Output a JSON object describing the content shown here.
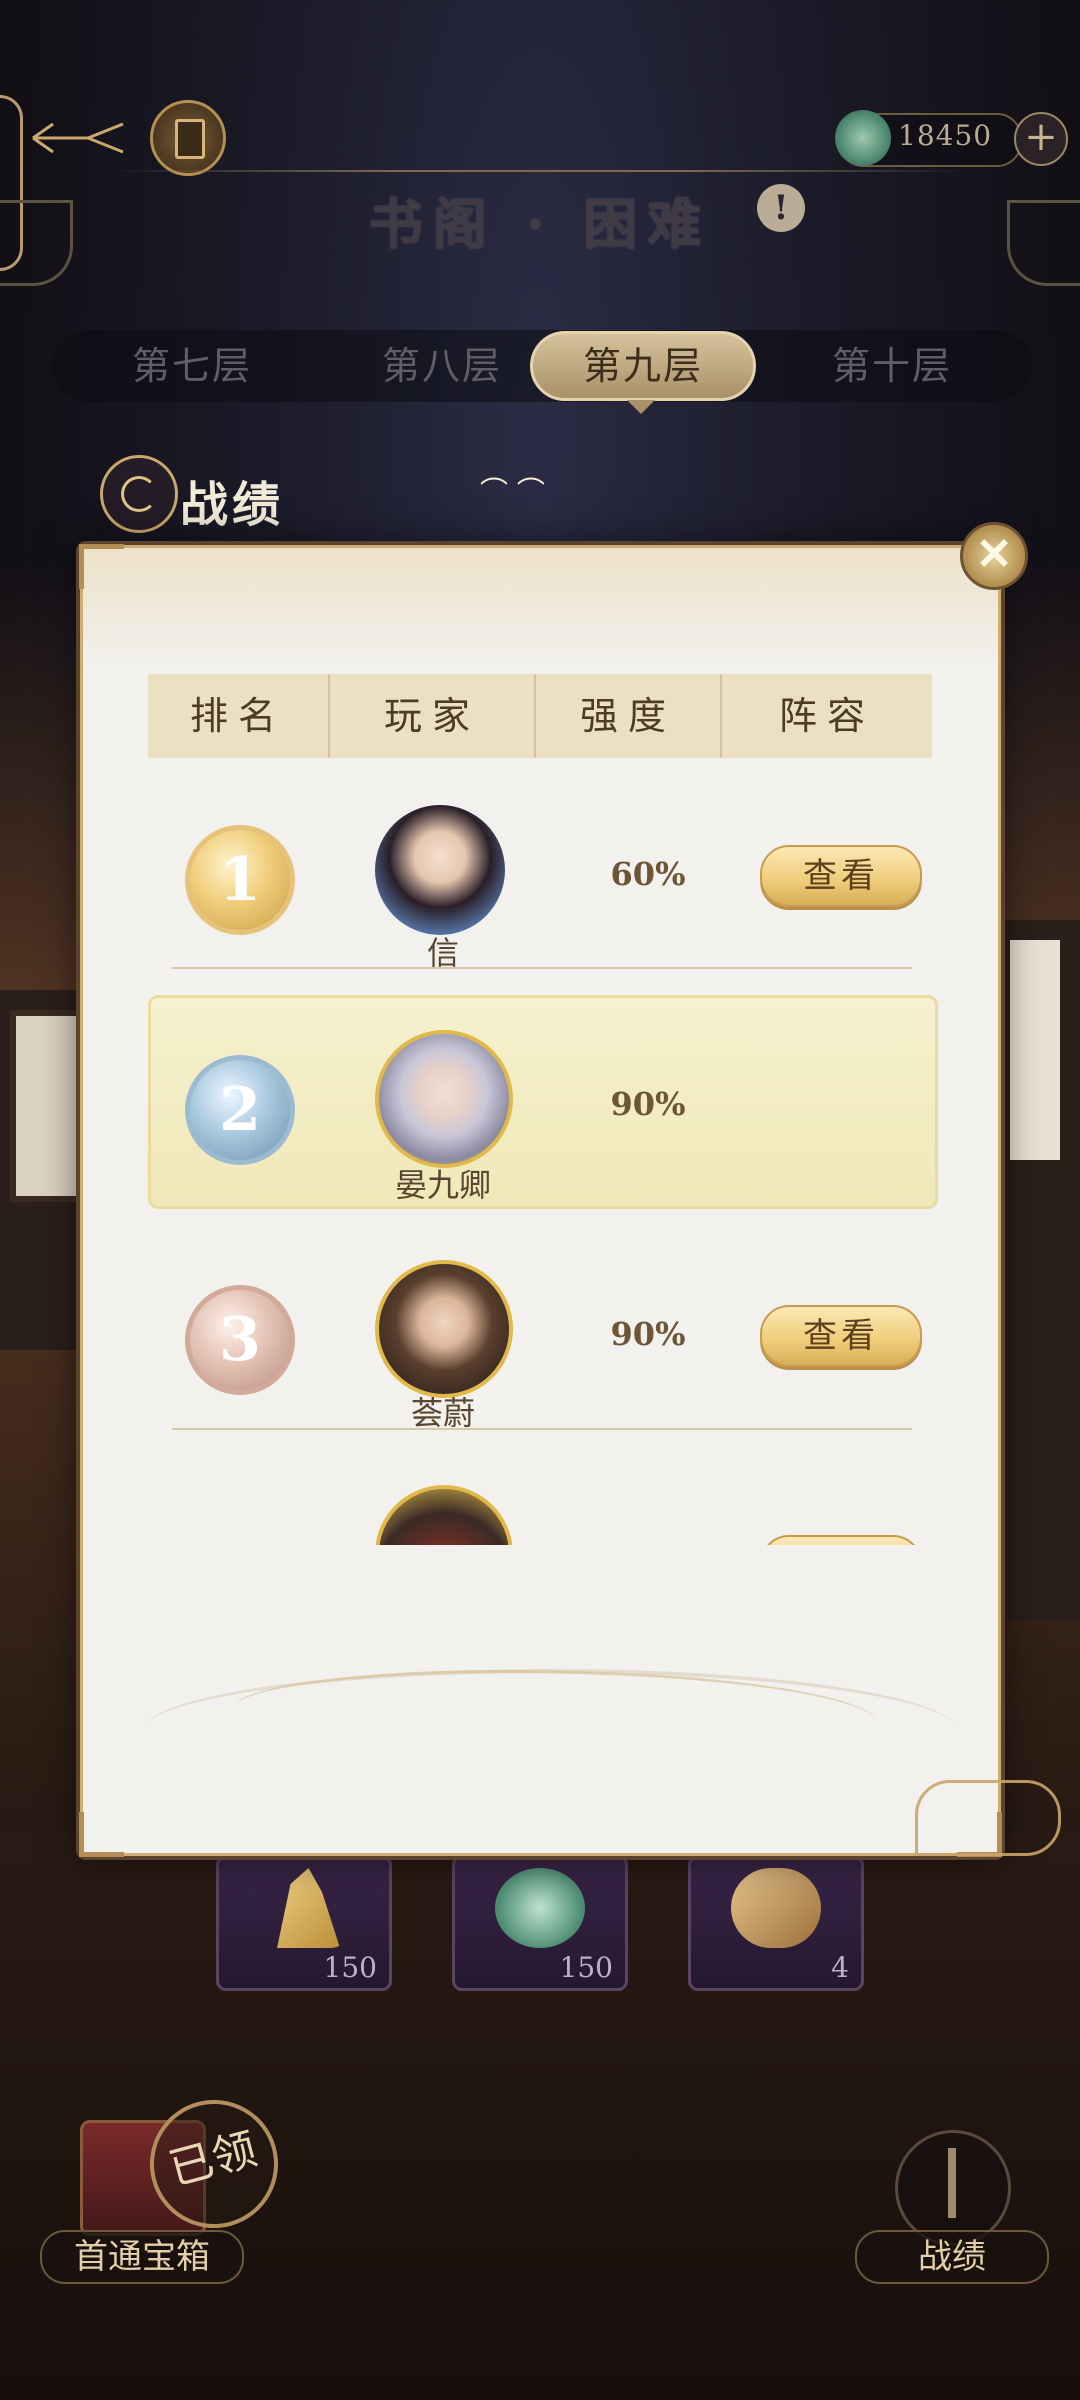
{
  "header": {
    "title": "书阁 · 困难",
    "currency_value": "18450",
    "plus_symbol": "+",
    "help_symbol": "!"
  },
  "tabs": [
    {
      "label": "第七层",
      "active": false
    },
    {
      "label": "第八层",
      "active": false
    },
    {
      "label": "第九层",
      "active": true
    },
    {
      "label": "第十层",
      "active": false
    }
  ],
  "section": {
    "title": "战绩"
  },
  "modal": {
    "close_symbol": "✕",
    "columns": [
      "排名",
      "玩家",
      "强度",
      "阵容"
    ],
    "rows": [
      {
        "rank": "1",
        "player": "信",
        "strength": "60%",
        "action": "查看",
        "highlighted": false
      },
      {
        "rank": "2",
        "player": "晏九卿",
        "strength": "90%",
        "action": "",
        "highlighted": true
      },
      {
        "rank": "3",
        "player": "荟蔚",
        "strength": "90%",
        "action": "查看",
        "highlighted": false
      }
    ]
  },
  "rewards": [
    {
      "icon": "gold-ingot-icon",
      "count": "150"
    },
    {
      "icon": "jade-icon",
      "count": "150"
    },
    {
      "icon": "wood-logs-icon",
      "count": "4"
    }
  ],
  "bottom": {
    "chest_label": "首通宝箱",
    "claimed_stamp": "已领",
    "record_label": "战绩"
  },
  "colors": {
    "accent_gold": "#cfae74",
    "panel_bg": "#f2f1ee",
    "highlight_row": "#f0e8b8"
  }
}
